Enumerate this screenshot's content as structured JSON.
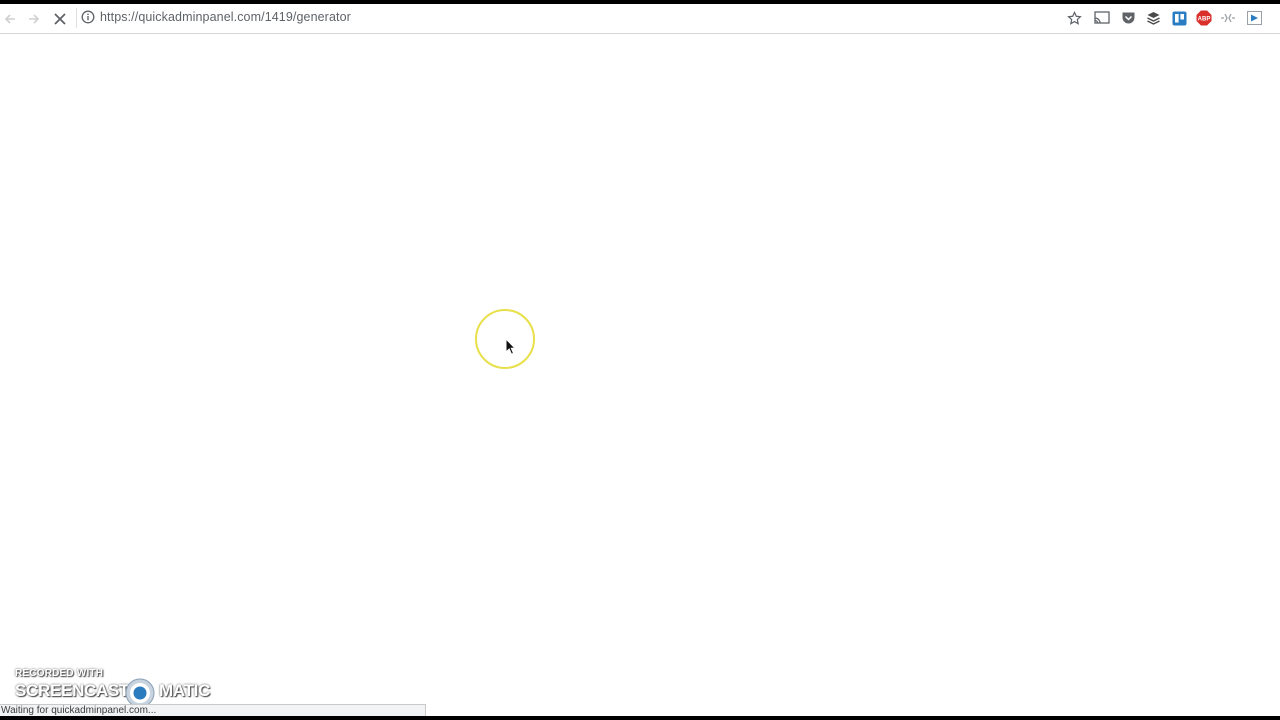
{
  "browser": {
    "url_text": "https://quickadminpanel.com/1419/generator",
    "status_text": "Waiting for quickadminpanel.com...",
    "icons": {
      "back": "arrow-left-icon",
      "forward": "arrow-right-icon",
      "stop": "close-icon",
      "site_info": "info-icon",
      "bookmark": "star-icon",
      "cast": "cast-icon",
      "pocket": "pocket-icon",
      "buffer": "stack-icon",
      "trello": "trello-icon",
      "adblock": "abp-icon",
      "extension": "puzzle-icon",
      "extension2": "play-icon"
    },
    "adblock_label": "ABP"
  },
  "watermark": {
    "line1": "RECORDED WITH",
    "brand_left": "SCREENCAST",
    "brand_right": "MATIC"
  },
  "colors": {
    "cursor_highlight": "#e8e04a",
    "page_background": "#ffffff",
    "adblock_red": "#d9302c",
    "trello_blue": "#2a7dc3"
  }
}
